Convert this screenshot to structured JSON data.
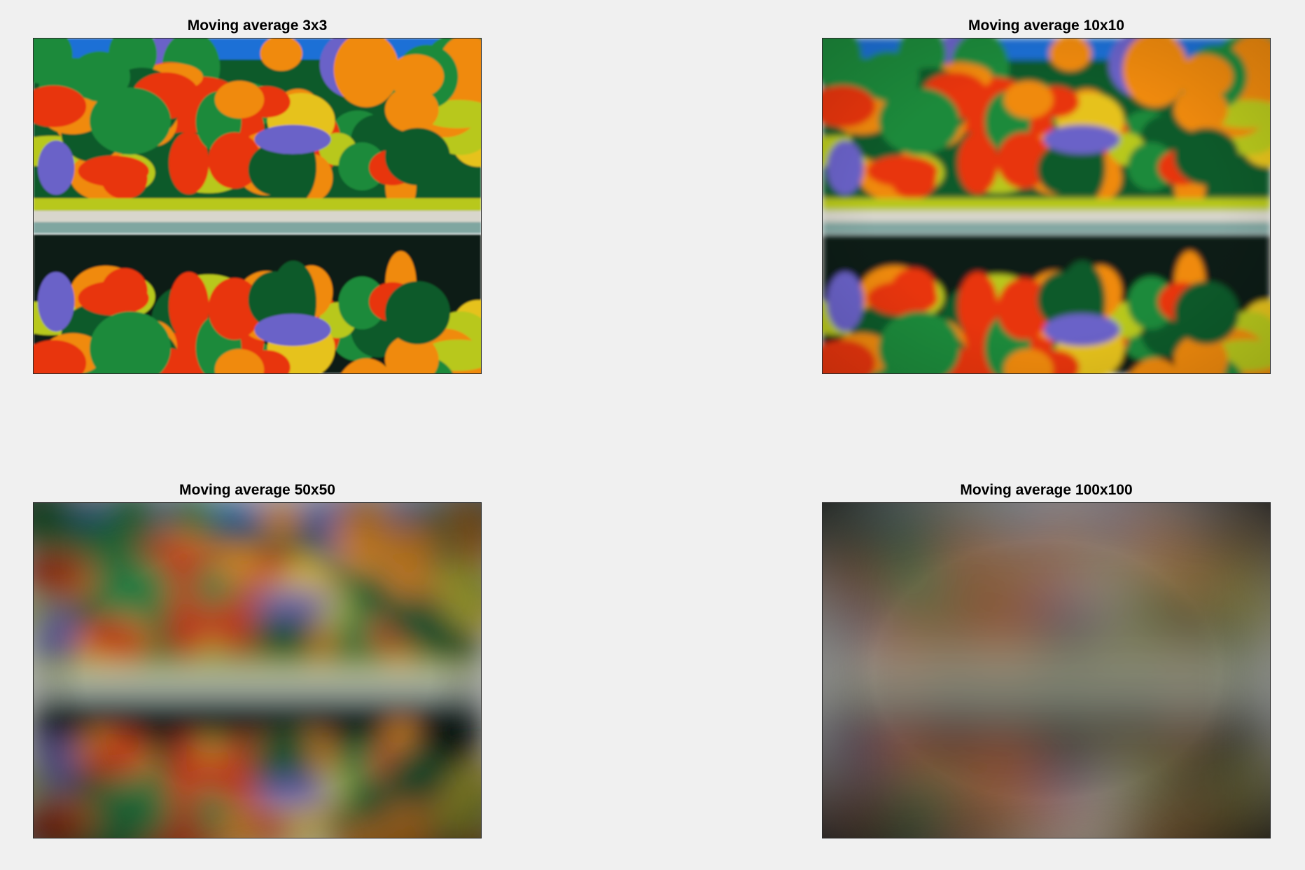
{
  "window": {
    "background": "#f0f0f0"
  },
  "panels": [
    {
      "title": "Moving average 3x3",
      "kernel_size": 3
    },
    {
      "title": "Moving average 10x10",
      "kernel_size": 10
    },
    {
      "title": "Moving average 50x50",
      "kernel_size": 50
    },
    {
      "title": "Moving average 100x100",
      "kernel_size": 100
    }
  ],
  "palette": {
    "sky": "#1a6fd6",
    "orange": "#f08a10",
    "red": "#e8340e",
    "yellow": "#e6c21a",
    "green": "#1f8a3a",
    "dark_green": "#0c5a2a",
    "purple": "#6a62c8",
    "lime": "#b8c81e",
    "shore": "#d8d6cc",
    "water_dark": "#0b1d12"
  }
}
